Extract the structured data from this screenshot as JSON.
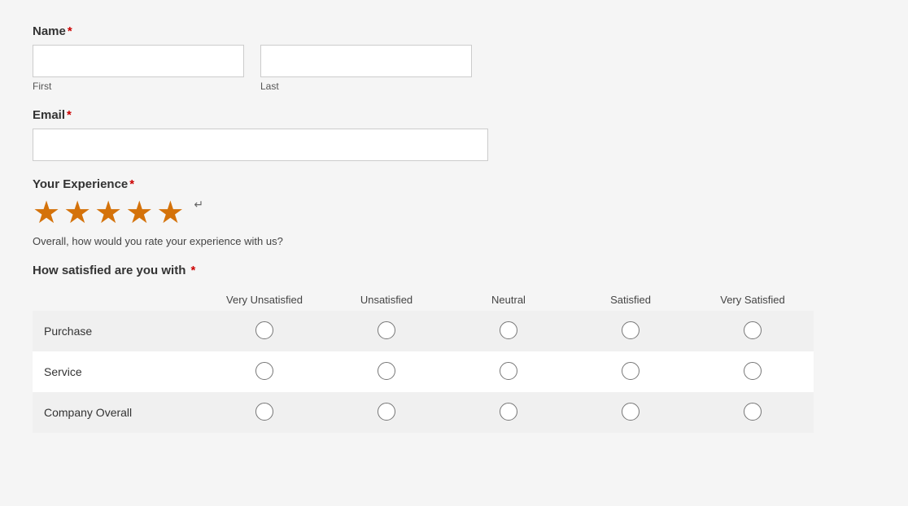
{
  "form": {
    "name_label": "Name",
    "name_required": "*",
    "first_label": "First",
    "last_label": "Last",
    "email_label": "Email",
    "email_required": "*",
    "experience_label": "Your Experience",
    "experience_required": "*",
    "experience_note": "Overall, how would you rate your experience with us?",
    "stars_count": 5,
    "satisfaction_label": "How satisfied are you with",
    "satisfaction_required": "*",
    "columns": [
      "Very Unsatisfied",
      "Unsatisfied",
      "Neutral",
      "Satisfied",
      "Very Satisfied"
    ],
    "rows": [
      {
        "label": "Purchase"
      },
      {
        "label": "Service"
      },
      {
        "label": "Company Overall"
      }
    ]
  }
}
